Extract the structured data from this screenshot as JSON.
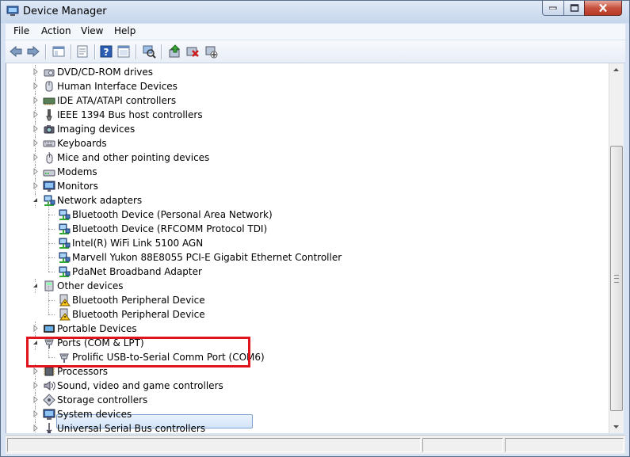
{
  "window": {
    "title": "Device Manager"
  },
  "menu": [
    "File",
    "Action",
    "View",
    "Help"
  ],
  "toolbar": [
    "back-icon",
    "forward-icon",
    "show-hide-console-tree-icon",
    "properties-icon",
    "help-icon",
    "console-icon",
    "scan-hardware-icon",
    "update-driver-icon",
    "uninstall-icon",
    "disable-device-icon"
  ],
  "tree": [
    {
      "label": "DVD/CD-ROM drives",
      "icon": "dvd-drive-icon",
      "level": 0,
      "state": "collapsed"
    },
    {
      "label": "Human Interface Devices",
      "icon": "hid-icon",
      "level": 0,
      "state": "collapsed"
    },
    {
      "label": "IDE ATA/ATAPI controllers",
      "icon": "ide-controller-icon",
      "level": 0,
      "state": "collapsed"
    },
    {
      "label": "IEEE 1394 Bus host controllers",
      "icon": "firewire-icon",
      "level": 0,
      "state": "collapsed"
    },
    {
      "label": "Imaging devices",
      "icon": "camera-icon",
      "level": 0,
      "state": "collapsed"
    },
    {
      "label": "Keyboards",
      "icon": "keyboard-icon",
      "level": 0,
      "state": "collapsed"
    },
    {
      "label": "Mice and other pointing devices",
      "icon": "mouse-icon",
      "level": 0,
      "state": "collapsed"
    },
    {
      "label": "Modems",
      "icon": "modem-icon",
      "level": 0,
      "state": "collapsed"
    },
    {
      "label": "Monitors",
      "icon": "monitor-icon",
      "level": 0,
      "state": "collapsed"
    },
    {
      "label": "Network adapters",
      "icon": "network-adapter-icon",
      "level": 0,
      "state": "expanded"
    },
    {
      "label": "Bluetooth Device (Personal Area Network)",
      "icon": "network-adapter-icon",
      "level": 1
    },
    {
      "label": "Bluetooth Device (RFCOMM Protocol TDI)",
      "icon": "network-adapter-icon",
      "level": 1
    },
    {
      "label": "Intel(R) WiFi Link 5100 AGN",
      "icon": "network-adapter-icon",
      "level": 1
    },
    {
      "label": "Marvell Yukon 88E8055 PCI-E Gigabit Ethernet Controller",
      "icon": "network-adapter-icon",
      "level": 1
    },
    {
      "label": "PdaNet Broadband Adapter",
      "icon": "network-adapter-icon",
      "level": 1
    },
    {
      "label": "Other devices",
      "icon": "other-devices-icon",
      "level": 0,
      "state": "expanded"
    },
    {
      "label": "Bluetooth Peripheral Device",
      "icon": "warning-device-icon",
      "level": 1
    },
    {
      "label": "Bluetooth Peripheral Device",
      "icon": "warning-device-icon",
      "level": 1
    },
    {
      "label": "Portable Devices",
      "icon": "portable-device-icon",
      "level": 0,
      "state": "collapsed"
    },
    {
      "label": "Ports (COM & LPT)",
      "icon": "port-icon",
      "level": 0,
      "state": "expanded"
    },
    {
      "label": "Prolific USB-to-Serial Comm Port (COM6)",
      "icon": "port-icon",
      "level": 1,
      "selected": true
    },
    {
      "label": "Processors",
      "icon": "processor-icon",
      "level": 0,
      "state": "collapsed"
    },
    {
      "label": "Sound, video and game controllers",
      "icon": "sound-icon",
      "level": 0,
      "state": "collapsed"
    },
    {
      "label": "Storage controllers",
      "icon": "storage-controller-icon",
      "level": 0,
      "state": "collapsed"
    },
    {
      "label": "System devices",
      "icon": "system-devices-icon",
      "level": 0,
      "state": "collapsed"
    },
    {
      "label": "Universal Serial Bus controllers",
      "icon": "usb-icon",
      "level": 0,
      "state": "collapsed"
    }
  ],
  "colors": {
    "highlight": "#e0141c",
    "selection": "#d3e4f8"
  }
}
